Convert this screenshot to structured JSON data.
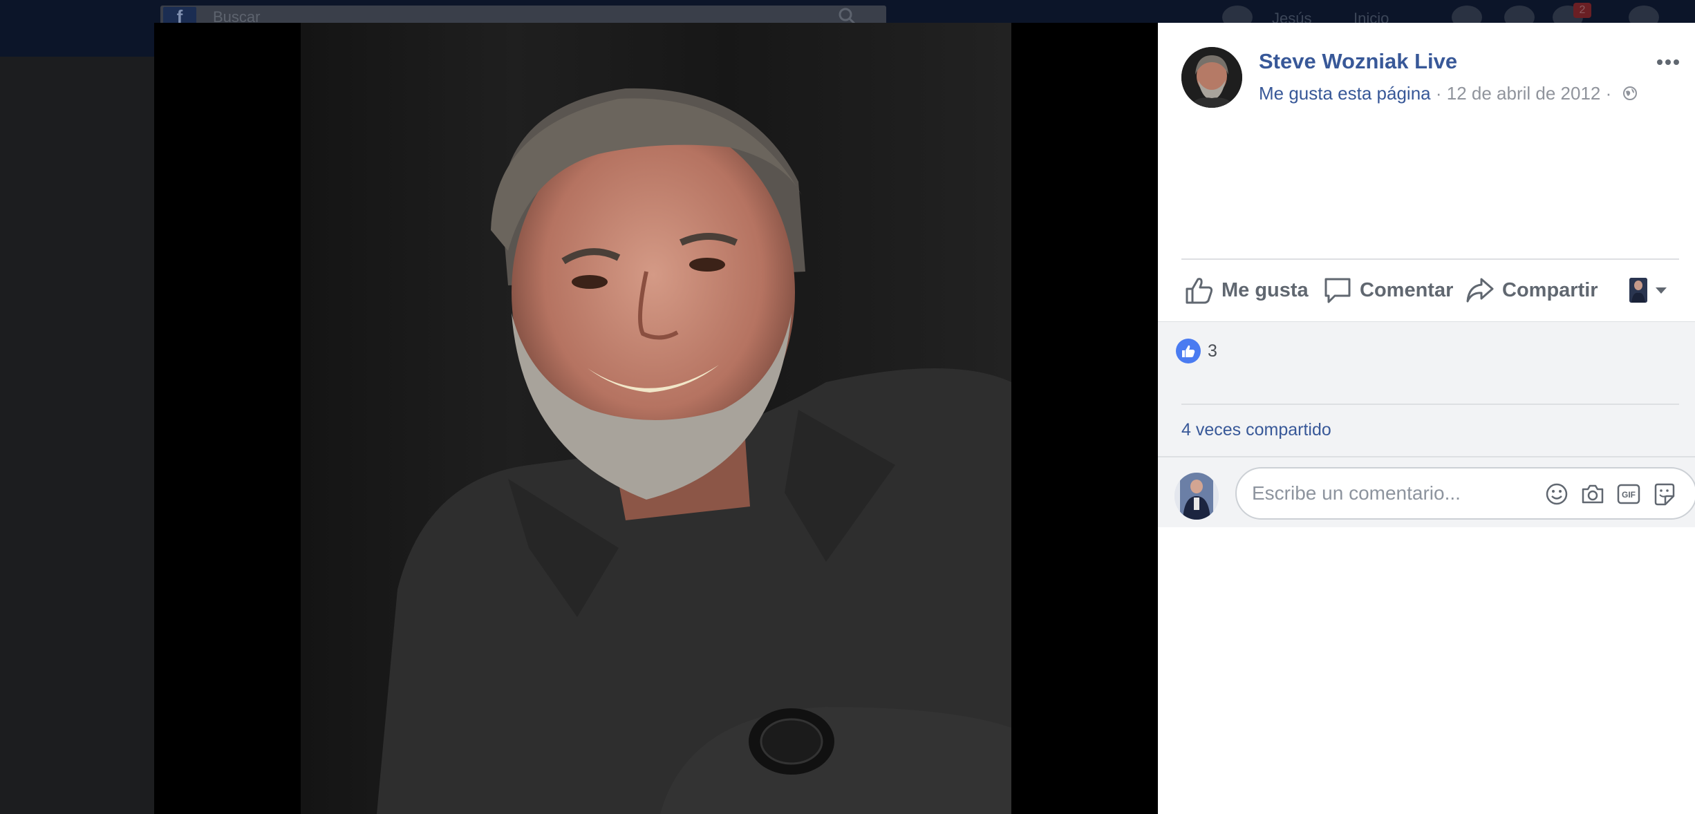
{
  "background": {
    "search_placeholder": "Buscar",
    "nav_items": [
      "Jesús",
      "Inicio"
    ],
    "notification_count": "2"
  },
  "post": {
    "page_name": "Steve Wozniak Live",
    "like_page_label": "Me gusta esta página",
    "separator": "·",
    "date": "12 de abril de 2012",
    "privacy_icon": "globe-icon"
  },
  "actions": {
    "like_label": "Me gusta",
    "comment_label": "Comentar",
    "share_label": "Compartir"
  },
  "reactions": {
    "count": "3",
    "shares_text": "4 veces compartido"
  },
  "comment_input": {
    "placeholder": "Escribe un comentario...",
    "icons": [
      "emoji-icon",
      "camera-icon",
      "gif-icon",
      "sticker-icon"
    ]
  },
  "colors": {
    "link_blue": "#385898",
    "like_blue": "#4a7bf1",
    "action_grey": "#606770",
    "muted_grey": "#90949c"
  }
}
